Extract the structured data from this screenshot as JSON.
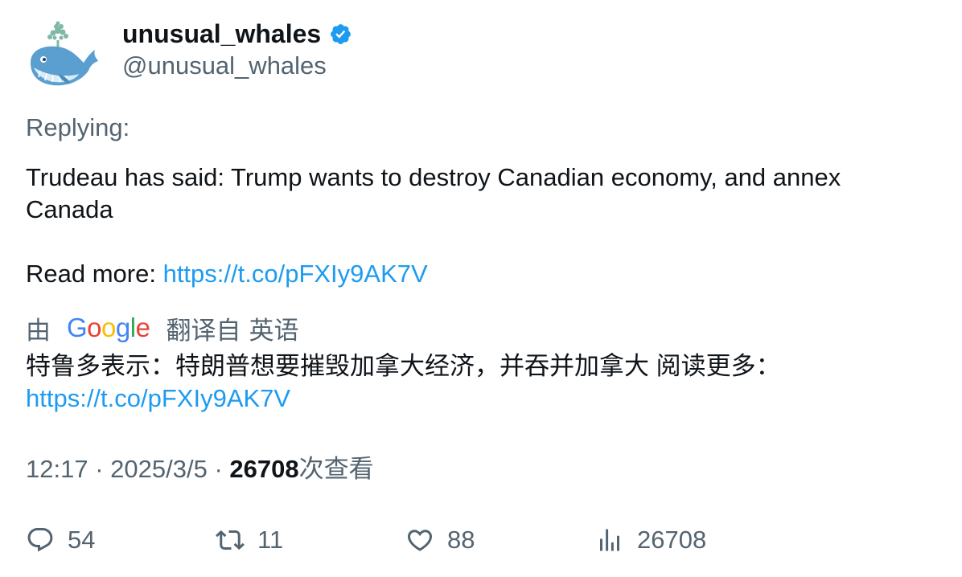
{
  "author": {
    "display_name": "unusual_whales",
    "handle": "@unusual_whales",
    "verified": true,
    "avatar_icon": "whale-icon"
  },
  "tweet": {
    "replying_label": "Replying:",
    "text_line": "Trudeau has said: Trump wants to destroy Canadian economy, and annex Canada",
    "read_more_label": "Read more: ",
    "link": "https://t.co/pFXIy9AK7V"
  },
  "translation": {
    "by_label": "由",
    "provider": "Google",
    "translated_from_label": "翻译自",
    "source_language": "英语",
    "translated_text": "特鲁多表示：特朗普想要摧毁加拿大经济，并吞并加拿大 阅读更多：",
    "translated_link": "https://t.co/pFXIy9AK7V"
  },
  "meta": {
    "time": "12:17",
    "separator": "·",
    "date": "2025/3/5",
    "views_count": "26708",
    "views_label": "次查看"
  },
  "actions": {
    "replies": "54",
    "retweets": "11",
    "likes": "88",
    "views": "26708"
  },
  "colors": {
    "accent": "#1d9bf0",
    "secondary_text": "#536471",
    "primary_text": "#0f1419"
  }
}
